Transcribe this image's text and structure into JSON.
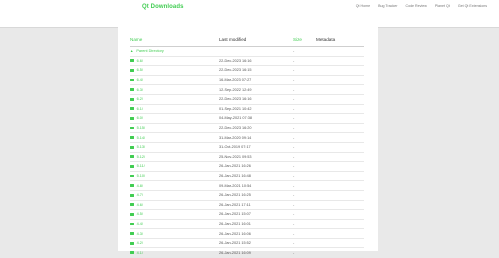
{
  "site": {
    "title": "Qt Downloads",
    "nav": [
      "Qt Home",
      "Bug Tracker",
      "Code Review",
      "Planet Qt",
      "Get Qt Extensions"
    ]
  },
  "table": {
    "headers": {
      "name": "Name",
      "modified": "Last modified",
      "size": "Size",
      "meta": "Metadata"
    },
    "parent": {
      "name": "Parent Directory",
      "modified": "",
      "size": "-",
      "meta": ""
    },
    "rows": [
      {
        "name": "6.6/",
        "modified": "22-Dec-2023 16:16",
        "size": "-"
      },
      {
        "name": "6.5/",
        "modified": "22-Dec-2023 16:15",
        "size": "-"
      },
      {
        "name": "6.4/",
        "modified": "16-Mar-2023 07:27",
        "size": "-"
      },
      {
        "name": "6.3/",
        "modified": "12-Sep-2022 12:49",
        "size": "-"
      },
      {
        "name": "6.2/",
        "modified": "22-Dec-2023 16:16",
        "size": "-"
      },
      {
        "name": "6.1/",
        "modified": "01-Sep-2021 10:42",
        "size": "-"
      },
      {
        "name": "6.0/",
        "modified": "04-May-2021 07:38",
        "size": "-"
      },
      {
        "name": "5.15/",
        "modified": "22-Dec-2023 16:20",
        "size": "-"
      },
      {
        "name": "5.14/",
        "modified": "31-Mar-2020 09:14",
        "size": "-"
      },
      {
        "name": "5.13/",
        "modified": "31-Oct-2019 07:17",
        "size": "-"
      },
      {
        "name": "5.12/",
        "modified": "25-Nov-2021 09:53",
        "size": "-"
      },
      {
        "name": "5.11/",
        "modified": "26-Jan-2021 16:26",
        "size": "-"
      },
      {
        "name": "5.10/",
        "modified": "26-Jan-2021 16:48",
        "size": "-"
      },
      {
        "name": "4.8/",
        "modified": "09-Mar-2021 10:54",
        "size": "-"
      },
      {
        "name": "4.7/",
        "modified": "26-Jan-2021 16:25",
        "size": "-"
      },
      {
        "name": "4.6/",
        "modified": "26-Jan-2021 17:11",
        "size": "-"
      },
      {
        "name": "4.5/",
        "modified": "26-Jan-2021 15:07",
        "size": "-"
      },
      {
        "name": "4.4/",
        "modified": "26-Jan-2021 16:01",
        "size": "-"
      },
      {
        "name": "4.3/",
        "modified": "26-Jan-2021 16:06",
        "size": "-"
      },
      {
        "name": "4.2/",
        "modified": "26-Jan-2021 15:52",
        "size": "-"
      },
      {
        "name": "4.1/",
        "modified": "26-Jan-2021 16:09",
        "size": "-"
      }
    ]
  },
  "colors": {
    "accent": "#41cd52",
    "background": "#e9e9e9"
  },
  "icons": {
    "parent": "arrow-up-icon",
    "folder": "folder-icon"
  }
}
